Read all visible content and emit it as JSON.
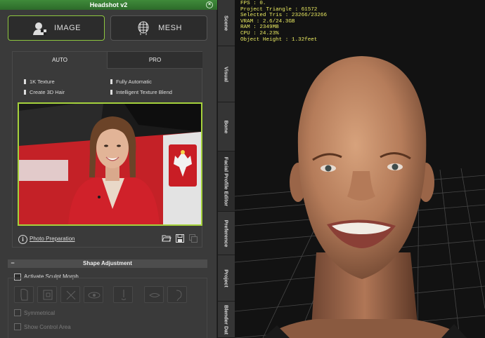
{
  "window": {
    "title": "Headshot v2",
    "close_glyph": "×"
  },
  "modes": {
    "image_label": "IMAGE",
    "mesh_label": "MESH"
  },
  "tabs": {
    "auto": "AUTO",
    "pro": "PRO"
  },
  "features": [
    "1K Texture",
    "Fully Automatic",
    "Create 3D Hair",
    "Intelligent Texture Blend"
  ],
  "photo": {
    "preparation_link": "Photo Preparation",
    "info_glyph": "i"
  },
  "shape_adjustment": {
    "header": "Shape Adjustment",
    "collapse_glyph": "−",
    "activate_sculpt_morph": "Activate Sculpt Morph",
    "symmetrical": "Symmetrical",
    "show_control_area": "Show Control Area"
  },
  "side_tabs": [
    "Scene",
    "Visual",
    "Bone",
    "Facial Profile Editor",
    "Preference",
    "Project",
    "Blender Dat"
  ],
  "stats": [
    "FPS : 0.",
    "Project Triangle : 61572",
    "Selected Tris : 23266/23266",
    "VRAM : 2.6/24.3GB",
    "RAM : 2349MB",
    "CPU : 24.23%",
    "Object Height : 1.32feet"
  ],
  "colors": {
    "accent_green": "#8ec63f",
    "title_green": "#3f8a3a",
    "stats_yellow": "#ecec62"
  }
}
